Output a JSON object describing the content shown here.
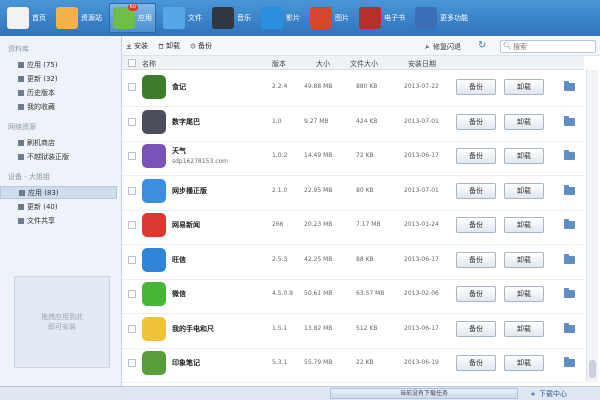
{
  "toolbar": {
    "items": [
      {
        "label": "首页",
        "icon": "home-icon",
        "color": "#f2f2f2"
      },
      {
        "label": "资源站",
        "icon": "resource-mail-icon",
        "color": "#f3b34a"
      },
      {
        "label": "应用",
        "icon": "apps-icon",
        "color": "#6cc04a",
        "badge": "60",
        "active": true
      },
      {
        "label": "文件",
        "icon": "file-manager-icon",
        "color": "#58a6e8"
      },
      {
        "label": "音乐",
        "icon": "music-icon",
        "color": "#2f3742"
      },
      {
        "label": "影片",
        "icon": "video-icon",
        "color": "#2b8fe0"
      },
      {
        "label": "图片",
        "icon": "photo-icon",
        "color": "#d8452f"
      },
      {
        "label": "电子书",
        "icon": "ebook-icon",
        "color": "#b5302a"
      },
      {
        "label": "更多功能",
        "icon": "more-features-icon",
        "color": "#3a6fb5"
      }
    ]
  },
  "sidebar": {
    "sections": [
      {
        "title": "资料库",
        "items": [
          {
            "label": "应用 (75)",
            "icon": "grid-icon"
          },
          {
            "label": "更新 (32)",
            "icon": "update-icon"
          },
          {
            "label": "历史版本",
            "icon": "history-icon"
          },
          {
            "label": "我的收藏",
            "icon": "star-icon"
          }
        ]
      },
      {
        "title": "网络资源",
        "items": [
          {
            "label": "刷机商店",
            "icon": "store-icon"
          },
          {
            "label": "不越狱装正版",
            "icon": "no-jailbreak-icon"
          }
        ]
      },
      {
        "title": "设备 - 大姐姐",
        "items": [
          {
            "label": "应用 (83)",
            "icon": "grid-icon",
            "active": true
          },
          {
            "label": "更新 (40)",
            "icon": "update-icon"
          },
          {
            "label": "文件共享",
            "icon": "share-icon"
          }
        ]
      }
    ],
    "dropzone": "拖拽应用到此\n即可安装"
  },
  "actions": {
    "install": "安装",
    "uninstall": "卸载",
    "backup": "备份",
    "repair": "修复闪退",
    "search_placeholder": "搜索"
  },
  "table": {
    "columns": {
      "name": "名称",
      "version": "版本",
      "size": "大小",
      "file_size": "文件大小",
      "install_date": "安装日期"
    },
    "rows": [
      {
        "name": "食记",
        "version": "2.2.4",
        "size": "49.88 MB",
        "file_size": "880 KB",
        "date": "2013-07-22",
        "icon_color": "#3d7c2c",
        "icon": "food-diary-app-icon"
      },
      {
        "name": "数字尾巴",
        "version": "1.0",
        "size": "9.27 MB",
        "file_size": "424 KB",
        "date": "2013-07-01",
        "icon_color": "#4a4f5a",
        "icon": "check-app-icon"
      },
      {
        "name": "天气",
        "sub": "sdp16278153.com",
        "version": "1.0.2",
        "size": "14.49 MB",
        "file_size": "72 KB",
        "date": "2013-06-17",
        "icon_color": "#7a53b8",
        "icon": "weather-app-icon"
      },
      {
        "name": "网步播正版",
        "version": "2.1.0",
        "size": "22.95 MB",
        "file_size": "80 KB",
        "date": "2013-07-01",
        "icon_color": "#3b8ee0",
        "icon": "player-app-icon"
      },
      {
        "name": "网易新闻",
        "version": "266",
        "size": "20.23 MB",
        "file_size": "7.17 MB",
        "date": "2013-01-24",
        "icon_color": "#d93a2f",
        "icon": "netease-news-app-icon"
      },
      {
        "name": "旺信",
        "version": "2.5.3",
        "size": "42.25 MB",
        "file_size": "88 KB",
        "date": "2013-06-17",
        "icon_color": "#2f86d9",
        "icon": "chat-app-icon"
      },
      {
        "name": "微信",
        "version": "4.5.0.9",
        "size": "50.61 MB",
        "file_size": "63.57 MB",
        "date": "2013-02-06",
        "icon_color": "#49b63a",
        "icon": "wechat-app-icon"
      },
      {
        "name": "我的手电和尺",
        "version": "1.5.1",
        "size": "13.82 MB",
        "file_size": "512 KB",
        "date": "2013-06-17",
        "icon_color": "#f0c23a",
        "icon": "flashlight-app-icon"
      },
      {
        "name": "印象笔记",
        "version": "5.3.1",
        "size": "55.79 MB",
        "file_size": "22 KB",
        "date": "2013-06-19",
        "icon_color": "#5a9e3a",
        "icon": "evernote-app-icon"
      }
    ],
    "backup_btn": "备份",
    "uninstall_btn": "卸载"
  },
  "status": {
    "task": "当前没有下载任务",
    "download_center": "下载中心"
  }
}
